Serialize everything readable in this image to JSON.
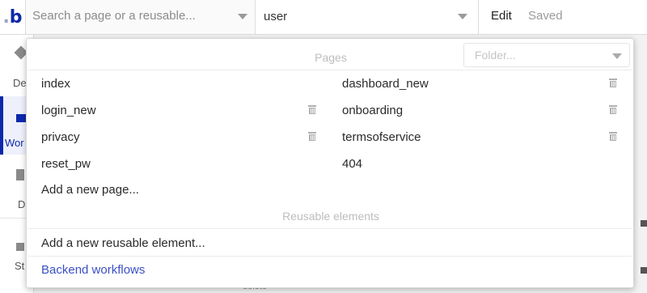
{
  "topbar": {
    "logo_text": "b",
    "logo_dot": ".",
    "page_search_placeholder": "Search a page or a reusable...",
    "element_value": "user",
    "edit_label": "Edit",
    "saved_label": "Saved"
  },
  "sidebar": {
    "items": [
      {
        "label": "De",
        "icon": "design-icon"
      },
      {
        "label": "Wor",
        "icon": "workflow-icon",
        "active": true
      },
      {
        "label": "D",
        "icon": "data-icon"
      },
      {
        "label": "St",
        "icon": "styles-icon"
      }
    ]
  },
  "background": {
    "delete_text": "delete"
  },
  "dropdown": {
    "pages_title": "Pages",
    "folder_placeholder": "Folder...",
    "pages": [
      {
        "name": "index",
        "deletable": false
      },
      {
        "name": "dashboard_new",
        "deletable": true
      },
      {
        "name": "login_new",
        "deletable": true
      },
      {
        "name": "onboarding",
        "deletable": true
      },
      {
        "name": "privacy",
        "deletable": true
      },
      {
        "name": "termsofservice",
        "deletable": true
      },
      {
        "name": "reset_pw",
        "deletable": false
      },
      {
        "name": "404",
        "deletable": false
      }
    ],
    "add_page_label": "Add a new page...",
    "reusable_title": "Reusable elements",
    "add_reusable_label": "Add a new reusable element...",
    "backend_label": "Backend workflows",
    "colors": {
      "accent": "#0c29ab",
      "link": "#3b50c5",
      "muted": "#bdbdbd"
    }
  }
}
